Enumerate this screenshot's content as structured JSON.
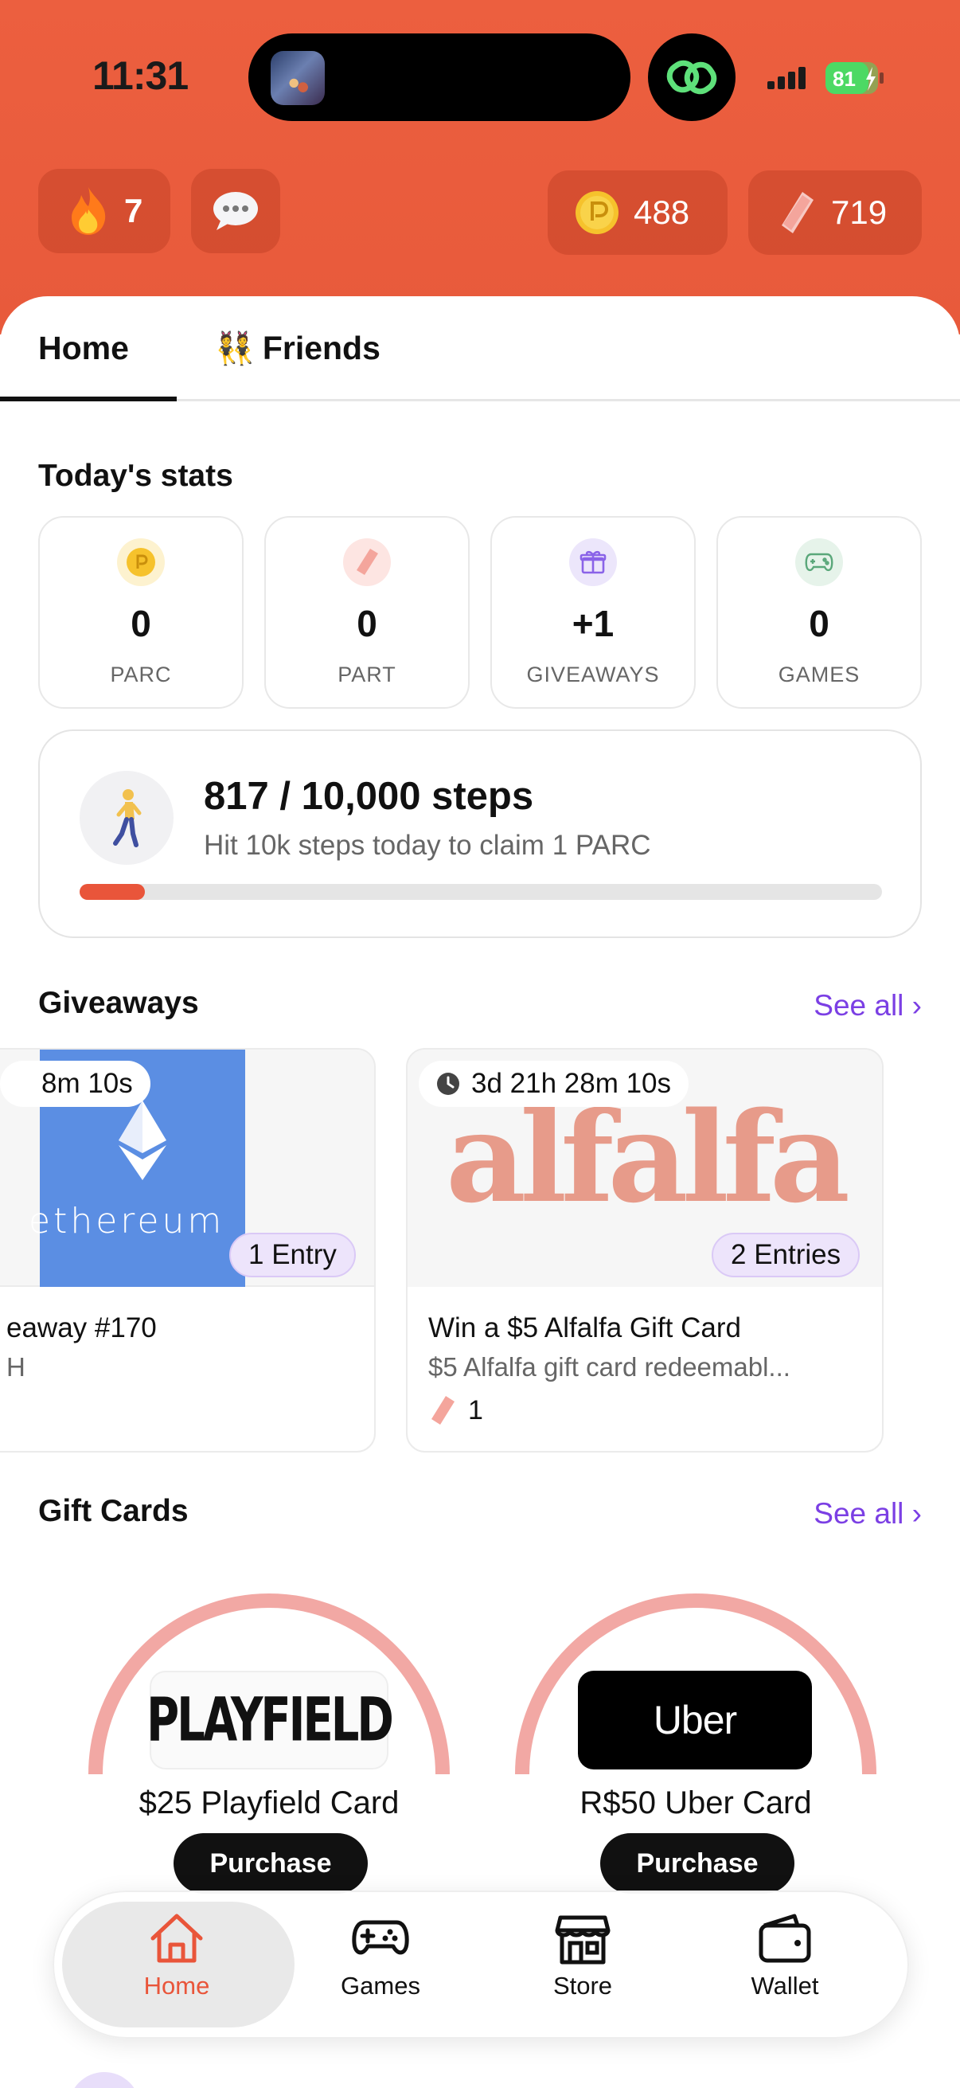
{
  "status_bar": {
    "time": "11:31",
    "battery": "81"
  },
  "header": {
    "streak": "7",
    "parc_balance": "488",
    "part_balance": "719"
  },
  "tabs": [
    {
      "label": "Home"
    },
    {
      "label": "Friends",
      "emoji": "👯"
    }
  ],
  "stats": {
    "title": "Today's stats",
    "items": [
      {
        "value": "0",
        "label": "PARC",
        "icon": "coin-icon",
        "color": "#f6c22c"
      },
      {
        "value": "0",
        "label": "PART",
        "icon": "ticket-icon",
        "color": "#f3a7a0"
      },
      {
        "value": "+1",
        "label": "GIVEAWAYS",
        "icon": "gift-icon",
        "color": "#8a63e8"
      },
      {
        "value": "0",
        "label": "GAMES",
        "icon": "gamepad-icon",
        "color": "#5aa77a"
      }
    ]
  },
  "steps": {
    "title": "817 / 10,000 steps",
    "subtitle": "Hit 10k steps today to claim 1 PARC",
    "progress": 0.0817
  },
  "giveaways": {
    "title": "Giveaways",
    "see_all": "See all ›",
    "items": [
      {
        "timer": "8m 10s",
        "image_text": "ethereum",
        "entries": "1 Entry",
        "title": "eaway #170",
        "desc": "H"
      },
      {
        "timer": "3d 21h 28m 10s",
        "image_text": "alfalfa",
        "entries": "2 Entries",
        "title": "Win a $5 Alfalfa Gift Card",
        "desc": "$5 Alfalfa gift card redeemabl...",
        "cost": "1"
      }
    ]
  },
  "gift_cards": {
    "title": "Gift Cards",
    "see_all": "See all ›",
    "items": [
      {
        "logo": "PLAYFIELD",
        "name": "$25 Playfield Card",
        "button": "Purchase"
      },
      {
        "logo": "Uber",
        "name": "R$50 Uber Card",
        "button": "Purchase"
      }
    ]
  },
  "nav": [
    {
      "label": "Home",
      "icon": "home-icon",
      "active": true
    },
    {
      "label": "Games",
      "icon": "gamepad-icon"
    },
    {
      "label": "Store",
      "icon": "store-icon"
    },
    {
      "label": "Wallet",
      "icon": "wallet-icon"
    }
  ],
  "colors": {
    "accent": "#e9553a",
    "link": "#7b3fe4",
    "header": "#ec5f3f"
  }
}
